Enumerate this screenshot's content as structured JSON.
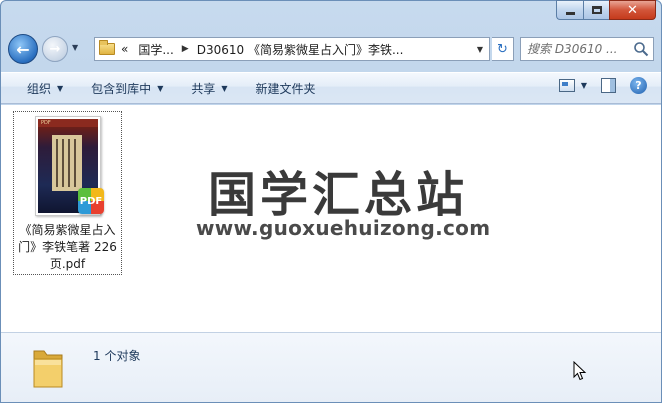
{
  "window": {
    "minimize_label": "",
    "maximize_label": "",
    "close_label": "✕"
  },
  "nav": {
    "back": "←",
    "forward": "→",
    "refresh": "↻"
  },
  "address": {
    "overflow": "«",
    "crumbs": [
      "国学...",
      "D30610 《简易紫微星占入门》李铁..."
    ]
  },
  "search": {
    "placeholder": "搜索 D30610 ..."
  },
  "toolbar": {
    "organize": "组织",
    "include_library": "包含到库中",
    "share": "共享",
    "new_folder": "新建文件夹",
    "help": "?"
  },
  "file": {
    "name": "《简易紫微星占入门》李铁笔著 226页.pdf",
    "badge": "PDF",
    "cover_strip": "PDF"
  },
  "watermark": {
    "title": "国学汇总站",
    "url": "www.guoxuehuizong.com"
  },
  "status": {
    "count": "1 个对象"
  },
  "icons": {
    "back": "back-arrow-icon",
    "forward": "forward-arrow-icon",
    "folder": "folder-icon",
    "refresh": "refresh-icon",
    "search": "search-icon",
    "view": "view-options-icon",
    "preview_pane": "preview-pane-icon",
    "help": "help-icon",
    "pdf": "pdf-badge-icon"
  },
  "colors": {
    "frame": "#b8cfe8",
    "command_bar": "#dbe7f5",
    "close_button": "#c53a1c",
    "accent": "#2a6fc0"
  }
}
